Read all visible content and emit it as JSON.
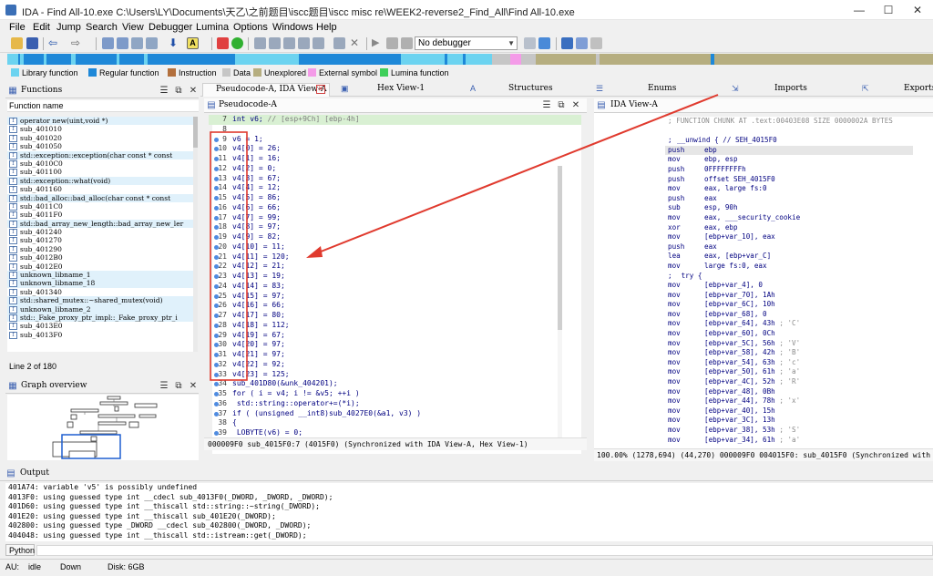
{
  "window": {
    "title": "IDA - Find All-10.exe C:\\Users\\LY\\Documents\\天乙\\之前题目\\iscc题目\\iscc misc re\\WEEK2-reverse2_Find_All\\Find All-10.exe",
    "minimize": "—",
    "maximize": "☐",
    "close": "✕"
  },
  "menu": [
    "File",
    "Edit",
    "Jump",
    "Search",
    "View",
    "Debugger",
    "Lumina",
    "Options",
    "Windows",
    "Help"
  ],
  "toolbar": {
    "debugger_select": "No debugger"
  },
  "legend": [
    {
      "label": "Library function",
      "color": "#6cd3f0"
    },
    {
      "label": "Regular function",
      "color": "#1e88d8"
    },
    {
      "label": "Instruction",
      "color": "#b3703d"
    },
    {
      "label": "Data",
      "color": "#c6c6c6"
    },
    {
      "label": "Unexplored",
      "color": "#b6ae80"
    },
    {
      "label": "External symbol",
      "color": "#f49be8"
    },
    {
      "label": "Lumina function",
      "color": "#3fcf5a"
    }
  ],
  "functions_panel": {
    "title": "Functions",
    "column": "Function name",
    "status": "Line 2 of 180",
    "items": [
      {
        "name": "operator new(uint,void *)",
        "lib": true
      },
      {
        "name": "sub_401010",
        "lib": false
      },
      {
        "name": "sub_401020",
        "lib": false
      },
      {
        "name": "sub_401050",
        "lib": false
      },
      {
        "name": "std::exception::exception(char const * const",
        "lib": true
      },
      {
        "name": "sub_4010C0",
        "lib": false
      },
      {
        "name": "sub_401100",
        "lib": false
      },
      {
        "name": "std::exception::what(void)",
        "lib": true
      },
      {
        "name": "sub_401160",
        "lib": false
      },
      {
        "name": "std::bad_alloc::bad_alloc(char const * const",
        "lib": true
      },
      {
        "name": "sub_4011C0",
        "lib": false
      },
      {
        "name": "sub_4011F0",
        "lib": false
      },
      {
        "name": "std::bad_array_new_length::bad_array_new_ler",
        "lib": true
      },
      {
        "name": "sub_401240",
        "lib": false
      },
      {
        "name": "sub_401270",
        "lib": false
      },
      {
        "name": "sub_401290",
        "lib": false
      },
      {
        "name": "sub_4012B0",
        "lib": false
      },
      {
        "name": "sub_4012E0",
        "lib": false
      },
      {
        "name": "unknown_libname_1",
        "lib": true
      },
      {
        "name": "unknown_libname_18",
        "lib": true
      },
      {
        "name": "sub_401340",
        "lib": false
      },
      {
        "name": "std::shared_mutex::~shared_mutex(void)",
        "lib": true
      },
      {
        "name": "unknown_libname_2",
        "lib": true
      },
      {
        "name": "std::_Fake_proxy_ptr_impl::_Fake_proxy_ptr_i",
        "lib": true
      },
      {
        "name": "sub_4013E0",
        "lib": false
      },
      {
        "name": "sub_4013F0",
        "lib": false
      }
    ]
  },
  "graph_overview": {
    "title": "Graph overview"
  },
  "tabs": [
    {
      "label": "Pseudocode-A, IDA View-A"
    },
    {
      "label": "Hex View-1"
    },
    {
      "label": "Structures"
    },
    {
      "label": "Enums"
    },
    {
      "label": "Imports"
    },
    {
      "label": "Exports"
    }
  ],
  "pseudocode": {
    "subtitle": "Pseudocode-A",
    "status": "000009F0 sub_4015F0:7 (4015F0) (Synchronized with IDA View-A, Hex View-1)",
    "lines": [
      {
        "n": "7",
        "text": "int v6; // [esp+9Ch] [ebp-4h]",
        "kind": "decl"
      },
      {
        "n": "8",
        "text": "",
        "kind": "plain"
      },
      {
        "n": "9",
        "text": "v6 = 1;",
        "kind": "plain"
      },
      {
        "n": "10",
        "text": "v4[0] = 26;",
        "kind": "plain"
      },
      {
        "n": "11",
        "text": "v4[1] = 16;",
        "kind": "plain"
      },
      {
        "n": "12",
        "text": "v4[2] = 0;",
        "kind": "plain"
      },
      {
        "n": "13",
        "text": "v4[3] = 67;",
        "kind": "plain"
      },
      {
        "n": "14",
        "text": "v4[4] = 12;",
        "kind": "plain"
      },
      {
        "n": "15",
        "text": "v4[5] = 86;",
        "kind": "plain"
      },
      {
        "n": "16",
        "text": "v4[6] = 66;",
        "kind": "plain"
      },
      {
        "n": "17",
        "text": "v4[7] = 99;",
        "kind": "plain"
      },
      {
        "n": "18",
        "text": "v4[8] = 97;",
        "kind": "plain"
      },
      {
        "n": "19",
        "text": "v4[9] = 82;",
        "kind": "plain"
      },
      {
        "n": "20",
        "text": "v4[10] = 11;",
        "kind": "plain"
      },
      {
        "n": "21",
        "text": "v4[11] = 120;",
        "kind": "plain"
      },
      {
        "n": "22",
        "text": "v4[12] = 21;",
        "kind": "plain"
      },
      {
        "n": "23",
        "text": "v4[13] = 19;",
        "kind": "plain"
      },
      {
        "n": "24",
        "text": "v4[14] = 83;",
        "kind": "plain"
      },
      {
        "n": "25",
        "text": "v4[15] = 97;",
        "kind": "plain"
      },
      {
        "n": "26",
        "text": "v4[16] = 66;",
        "kind": "plain"
      },
      {
        "n": "27",
        "text": "v4[17] = 80;",
        "kind": "plain"
      },
      {
        "n": "28",
        "text": "v4[18] = 112;",
        "kind": "plain"
      },
      {
        "n": "29",
        "text": "v4[19] = 67;",
        "kind": "plain"
      },
      {
        "n": "30",
        "text": "v4[20] = 97;",
        "kind": "plain"
      },
      {
        "n": "31",
        "text": "v4[21] = 97;",
        "kind": "plain"
      },
      {
        "n": "32",
        "text": "v4[22] = 92;",
        "kind": "plain"
      },
      {
        "n": "33",
        "text": "v4[23] = 125;",
        "kind": "plain"
      },
      {
        "n": "34",
        "text": "sub_401D80(&unk_404201);",
        "kind": "plain"
      },
      {
        "n": "35",
        "text": "for ( i = v4; i != &v5; ++i )",
        "kind": "plain"
      },
      {
        "n": "36",
        "text": "  std::string::operator+=(*i);",
        "kind": "plain"
      },
      {
        "n": "37",
        "text": "if ( (unsigned __int8)sub_4027E0(&a1, v3) )",
        "kind": "plain"
      },
      {
        "n": "38",
        "text": "{",
        "kind": "plain"
      },
      {
        "n": "39",
        "text": "  LOBYTE(v6) = 0;",
        "kind": "plain"
      }
    ]
  },
  "ida_view": {
    "title": "IDA View-A",
    "status": "100.00% (1278,694) (44,270) 000009F0 004015F0: sub_4015F0 (Synchronized with",
    "lines": [
      {
        "m": "",
        "o": "",
        "c": "; FUNCTION CHUNK AT .text:00403E08 SIZE 0000002A BYTES"
      },
      {
        "m": "",
        "o": "",
        "c": ""
      },
      {
        "m": ";",
        "o": "__unwind { // SEH_4015F0",
        "c": ""
      },
      {
        "m": "push",
        "o": "ebp",
        "c": ""
      },
      {
        "m": "mov",
        "o": "ebp, esp",
        "c": ""
      },
      {
        "m": "push",
        "o": "0FFFFFFFFh",
        "c": ""
      },
      {
        "m": "push",
        "o": "offset SEH_4015F0",
        "c": ""
      },
      {
        "m": "mov",
        "o": "eax, large fs:0",
        "c": ""
      },
      {
        "m": "push",
        "o": "eax",
        "c": ""
      },
      {
        "m": "sub",
        "o": "esp, 90h",
        "c": ""
      },
      {
        "m": "mov",
        "o": "eax, ___security_cookie",
        "c": ""
      },
      {
        "m": "xor",
        "o": "eax, ebp",
        "c": ""
      },
      {
        "m": "mov",
        "o": "[ebp+var_10], eax",
        "c": ""
      },
      {
        "m": "push",
        "o": "eax",
        "c": ""
      },
      {
        "m": "lea",
        "o": "eax, [ebp+var_C]",
        "c": ""
      },
      {
        "m": "mov",
        "o": "large fs:0, eax",
        "c": ""
      },
      {
        "m": ";",
        "o": "  try {",
        "c": ""
      },
      {
        "m": "mov",
        "o": "[ebp+var_4], 0",
        "c": ""
      },
      {
        "m": "mov",
        "o": "[ebp+var_70], 1Ah",
        "c": ""
      },
      {
        "m": "mov",
        "o": "[ebp+var_6C], 10h",
        "c": ""
      },
      {
        "m": "mov",
        "o": "[ebp+var_68], 0",
        "c": ""
      },
      {
        "m": "mov",
        "o": "[ebp+var_64], 43h",
        "c": "; 'C'"
      },
      {
        "m": "mov",
        "o": "[ebp+var_60], 0Ch",
        "c": ""
      },
      {
        "m": "mov",
        "o": "[ebp+var_5C], 56h",
        "c": "; 'V'"
      },
      {
        "m": "mov",
        "o": "[ebp+var_58], 42h",
        "c": "; 'B'"
      },
      {
        "m": "mov",
        "o": "[ebp+var_54], 63h",
        "c": "; 'c'"
      },
      {
        "m": "mov",
        "o": "[ebp+var_50], 61h",
        "c": "; 'a'"
      },
      {
        "m": "mov",
        "o": "[ebp+var_4C], 52h",
        "c": "; 'R'"
      },
      {
        "m": "mov",
        "o": "[ebp+var_48], 0Bh",
        "c": ""
      },
      {
        "m": "mov",
        "o": "[ebp+var_44], 78h",
        "c": "; 'x'"
      },
      {
        "m": "mov",
        "o": "[ebp+var_40], 15h",
        "c": ""
      },
      {
        "m": "mov",
        "o": "[ebp+var_3C], 13h",
        "c": ""
      },
      {
        "m": "mov",
        "o": "[ebp+var_38], 53h",
        "c": "; 'S'"
      },
      {
        "m": "mov",
        "o": "[ebp+var_34], 61h",
        "c": "; 'a'"
      }
    ]
  },
  "output": {
    "title": "Output",
    "lines": [
      "401A74: variable 'v5' is possibly undefined",
      "4013F0: using guessed type int __cdecl sub_4013F0(_DWORD, _DWORD, _DWORD);",
      "401D60: using guessed type int __thiscall std::string::~string(_DWORD);",
      "401E20: using guessed type int __thiscall sub_401E20(_DWORD);",
      "402800: using guessed type _DWORD __cdecl sub_402800(_DWORD, _DWORD);",
      "404048: using guessed type int __thiscall std::istream::get(_DWORD);"
    ],
    "python_tab": "Python"
  },
  "statusbar": {
    "au": "AU:",
    "state": "idle",
    "direction": "Down",
    "disk": "Disk: 6GB"
  }
}
